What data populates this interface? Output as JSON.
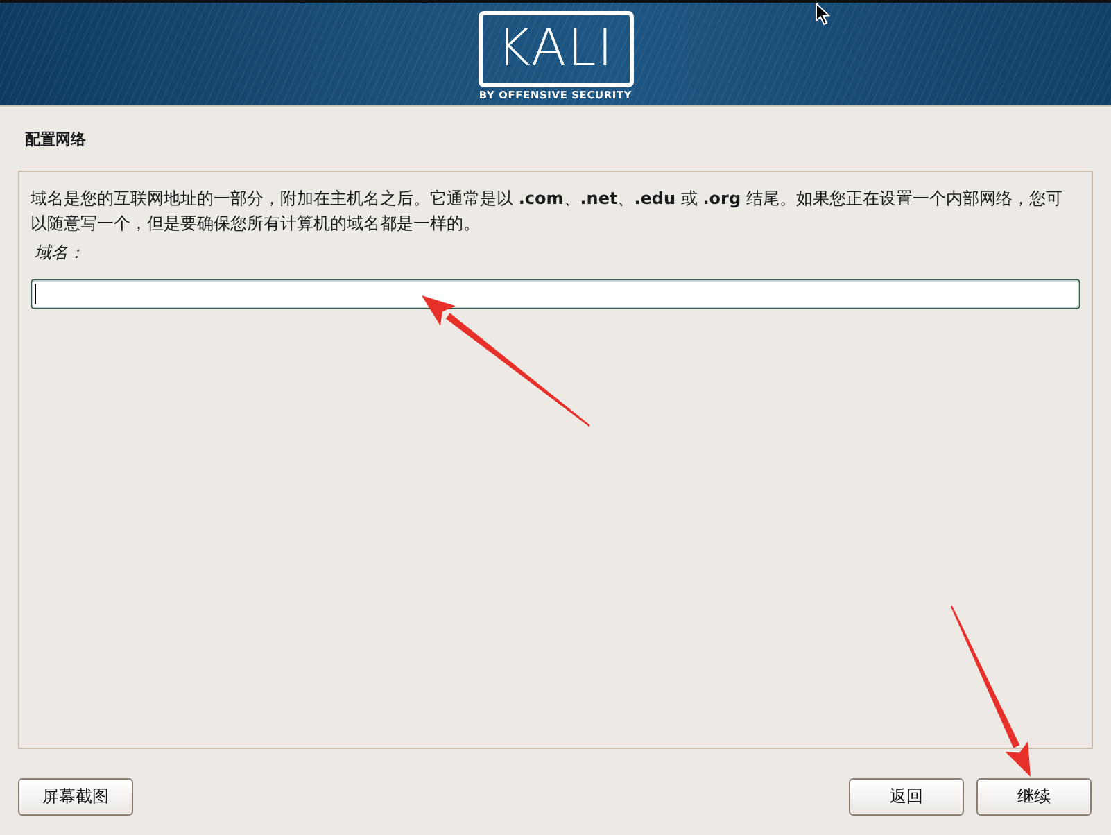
{
  "header": {
    "logo_text": "KALI",
    "logo_tagline": "BY OFFENSIVE SECURITY"
  },
  "page_title": "配置网络",
  "description": "域名是您的互联网地址的一部分，附加在主机名之后。它通常是以 **.com**、**.net**、**.edu** 或 **.org** 结尾。如果您正在设置一个内部网络，您可以随意写一个，但是要确保您所有计算机的域名都是一样的。",
  "field": {
    "label": "域名：",
    "focused": true
  },
  "footer": {
    "left_buttons": [
      "屏幕截图"
    ],
    "right_buttons": [
      "返回",
      "继续"
    ]
  }
}
